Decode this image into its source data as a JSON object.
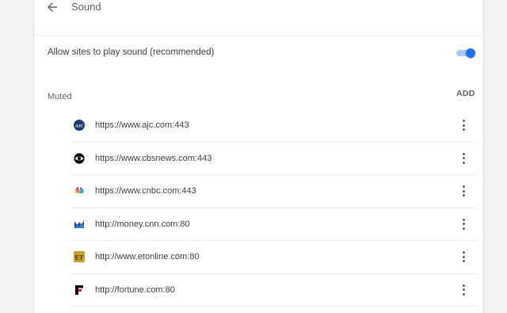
{
  "header": {
    "title": "Sound"
  },
  "setting": {
    "label": "Allow sites to play sound (recommended)",
    "enabled": true
  },
  "muted_section": {
    "label": "Muted",
    "add_label": "ADD"
  },
  "sites": [
    {
      "url": "https://www.ajc.com:443",
      "icon": "ajc-icon"
    },
    {
      "url": "https://www.cbsnews.com:443",
      "icon": "cbs-eye-icon"
    },
    {
      "url": "https://www.cnbc.com:443",
      "icon": "nbc-peacock-icon"
    },
    {
      "url": "http://money.cnn.com:80",
      "icon": "cnn-money-icon"
    },
    {
      "url": "http://www.etonline.com:80",
      "icon": "et-icon"
    },
    {
      "url": "http://fortune.com:80",
      "icon": "fortune-icon"
    }
  ],
  "colors": {
    "accent": "#1a73e8",
    "toggle_track": "#a8c7fa",
    "page_background": "#f1f3f4"
  }
}
